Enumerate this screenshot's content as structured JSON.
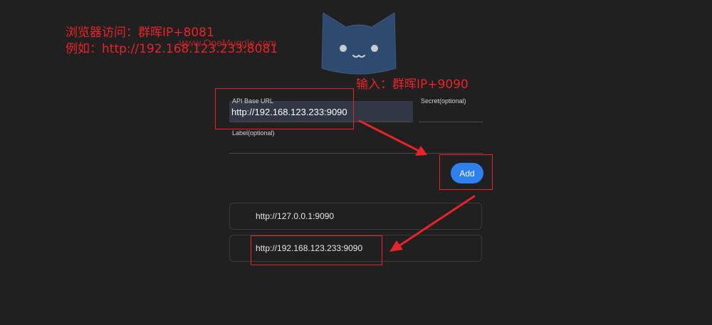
{
  "annotations": {
    "line1": "浏览器访问：群晖IP+8081",
    "line2": "例如：http://192.168.123.233:8081",
    "input_hint": "输入：群晖IP+9090",
    "watermark": "www.OneMuggle.com"
  },
  "form": {
    "api_base_url_label": "API Base URL",
    "api_base_url_value": "http://192.168.123.233:9090",
    "secret_label": "Secret(optional)",
    "secret_value": "",
    "label_label": "Label(optional)",
    "label_value": "",
    "add_label": "Add"
  },
  "backends": [
    {
      "url": "http://127.0.0.1:9090"
    },
    {
      "url": "http://192.168.123.233:9090"
    }
  ],
  "colors": {
    "background": "#202020",
    "accent": "#2f80ed",
    "annotation": "#e8232a",
    "logo": "#2f4a6f"
  },
  "icons": {
    "logo": "cat-logo-icon"
  }
}
